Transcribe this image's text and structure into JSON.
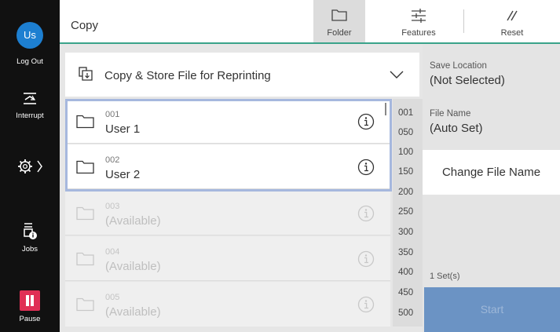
{
  "sidebar": {
    "avatar": "Us",
    "logout": "Log Out",
    "interrupt": "Interrupt",
    "jobs": "Jobs",
    "pause": "Pause"
  },
  "header": {
    "title": "Copy",
    "folder": "Folder",
    "features": "Features",
    "reset": "Reset"
  },
  "dropdown": {
    "label": "Copy & Store File for Reprinting"
  },
  "folders": [
    {
      "number": "001",
      "name": "User 1",
      "available": false
    },
    {
      "number": "002",
      "name": "User 2",
      "available": false
    },
    {
      "number": "003",
      "name": "(Available)",
      "available": true
    },
    {
      "number": "004",
      "name": "(Available)",
      "available": true
    },
    {
      "number": "005",
      "name": "(Available)",
      "available": true
    }
  ],
  "index": [
    "001",
    "050",
    "100",
    "150",
    "200",
    "250",
    "300",
    "350",
    "400",
    "450",
    "500"
  ],
  "right": {
    "save_location_label": "Save Location",
    "save_location_value": "(Not Selected)",
    "file_name_label": "File Name",
    "file_name_value": "(Auto Set)",
    "change_file_name": "Change File Name",
    "sets": "1 Set(s)",
    "start": "Start"
  },
  "colors": {
    "accent_line": "#3aa38a",
    "pause": "#e02f55",
    "avatar": "#1d7fd1",
    "start": "#6b93c4",
    "selection": "#a6b8de"
  }
}
